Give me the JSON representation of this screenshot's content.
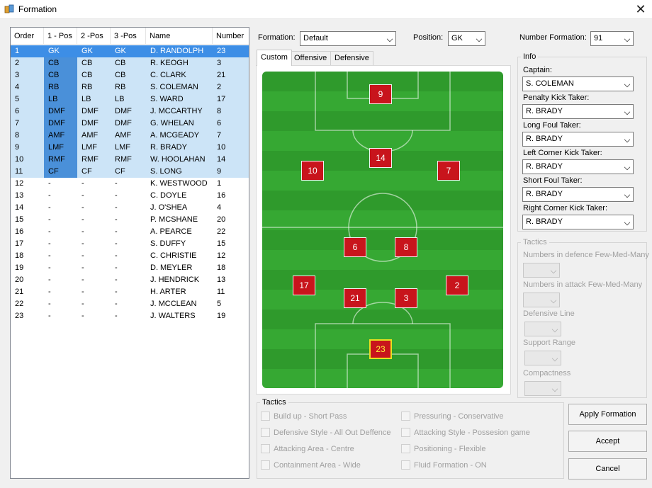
{
  "window": {
    "title": "Formation"
  },
  "table": {
    "headers": [
      "Order",
      "1 - Pos",
      "2 -Pos",
      "3 -Pos",
      "Name",
      "Number"
    ],
    "rows": [
      [
        "1",
        "GK",
        "GK",
        "GK",
        "D. RANDOLPH",
        "23"
      ],
      [
        "2",
        "CB",
        "CB",
        "CB",
        "R. KEOGH",
        "3"
      ],
      [
        "3",
        "CB",
        "CB",
        "CB",
        "C. CLARK",
        "21"
      ],
      [
        "4",
        "RB",
        "RB",
        "RB",
        "S. COLEMAN",
        "2"
      ],
      [
        "5",
        "LB",
        "LB",
        "LB",
        "S. WARD",
        "17"
      ],
      [
        "6",
        "DMF",
        "DMF",
        "DMF",
        "J. MCCARTHY",
        "8"
      ],
      [
        "7",
        "DMF",
        "DMF",
        "DMF",
        "G. WHELAN",
        "6"
      ],
      [
        "8",
        "AMF",
        "AMF",
        "AMF",
        "A. MCGEADY",
        "7"
      ],
      [
        "9",
        "LMF",
        "LMF",
        "LMF",
        "R. BRADY",
        "10"
      ],
      [
        "10",
        "RMF",
        "RMF",
        "RMF",
        "W. HOOLAHAN",
        "14"
      ],
      [
        "11",
        "CF",
        "CF",
        "CF",
        "S. LONG",
        "9"
      ],
      [
        "12",
        "-",
        "-",
        "-",
        "K. WESTWOOD",
        "1"
      ],
      [
        "13",
        "-",
        "-",
        "-",
        "C. DOYLE",
        "16"
      ],
      [
        "14",
        "-",
        "-",
        "-",
        "J. O'SHEA",
        "4"
      ],
      [
        "15",
        "-",
        "-",
        "-",
        "P. MCSHANE",
        "20"
      ],
      [
        "16",
        "-",
        "-",
        "-",
        "A. PEARCE",
        "22"
      ],
      [
        "17",
        "-",
        "-",
        "-",
        "S. DUFFY",
        "15"
      ],
      [
        "18",
        "-",
        "-",
        "-",
        "C. CHRISTIE",
        "12"
      ],
      [
        "19",
        "-",
        "-",
        "-",
        "D. MEYLER",
        "18"
      ],
      [
        "20",
        "-",
        "-",
        "-",
        "J. HENDRICK",
        "13"
      ],
      [
        "21",
        "-",
        "-",
        "-",
        "H. ARTER",
        "11"
      ],
      [
        "22",
        "-",
        "-",
        "-",
        "J. MCCLEAN",
        "5"
      ],
      [
        "23",
        "-",
        "-",
        "-",
        "J. WALTERS",
        "19"
      ]
    ]
  },
  "controls": {
    "formation_label": "Formation:",
    "formation_value": "Default",
    "position_label": "Position:",
    "position_value": "GK",
    "number_formation_label": "Number Formation:",
    "number_formation_value": "91"
  },
  "tabs": [
    "Custom",
    "Offensive",
    "Defensive"
  ],
  "pitch_players": [
    {
      "number": "9"
    },
    {
      "number": "14"
    },
    {
      "number": "10"
    },
    {
      "number": "7"
    },
    {
      "number": "6"
    },
    {
      "number": "8"
    },
    {
      "number": "17"
    },
    {
      "number": "2"
    },
    {
      "number": "21"
    },
    {
      "number": "3"
    },
    {
      "number": "23"
    }
  ],
  "info": {
    "title": "Info",
    "fields": [
      {
        "label": "Captain:",
        "value": "S. COLEMAN"
      },
      {
        "label": "Penalty Kick Taker:",
        "value": "R. BRADY"
      },
      {
        "label": "Long Foul Taker:",
        "value": "R. BRADY"
      },
      {
        "label": "Left Corner Kick Taker:",
        "value": "R. BRADY"
      },
      {
        "label": "Short Foul Taker:",
        "value": "R. BRADY"
      },
      {
        "label": "Right Corner Kick Taker:",
        "value": "R. BRADY"
      }
    ]
  },
  "tactics_right": {
    "title": "Tactics",
    "fields": [
      "Numbers in defence Few-Med-Many",
      "Numbers in attack Few-Med-Many",
      "Defensive Line",
      "Support Range",
      "Compactness"
    ]
  },
  "tactics_bottom": {
    "title": "Tactics",
    "options": [
      "Build up - Short Pass",
      "Defensive Style - All Out Deffence",
      "Attacking Area - Centre",
      "Containment Area - Wide",
      "Pressuring - Conservative",
      "Attacking Style - Possesion game",
      "Positioning - Flexible",
      "Fluid Formation - ON"
    ]
  },
  "buttons": {
    "apply": "Apply Formation",
    "accept": "Accept",
    "cancel": "Cancel"
  },
  "colors": {
    "selection": "#cce4f7",
    "selected_row": "#3d8ee6",
    "player_marker": "#c8141c",
    "gk_border": "#e8e020",
    "pitch": "#2f9a2c"
  }
}
